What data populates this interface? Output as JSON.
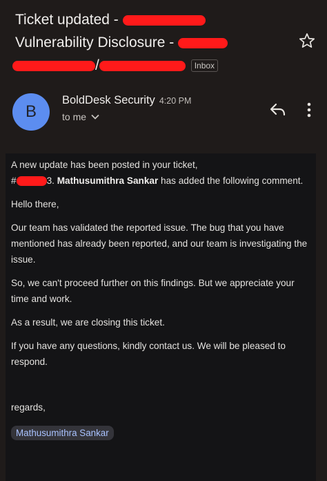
{
  "subject": {
    "line1": "Ticket updated -",
    "line2": "Vulnerability Disclosure -",
    "line3_sep": "/",
    "inbox_label": "Inbox"
  },
  "sender": {
    "avatar_letter": "B",
    "name": "BoldDesk Security",
    "time": "4:20 PM",
    "to": "to me"
  },
  "message": {
    "intro_line1": "A new update has been posted in your ticket,",
    "ticket_hash": "#",
    "ticket_suffix": "3.",
    "commenter": "Mathusumithra Sankar",
    "intro_tail": "has added the following comment.",
    "greeting": "Hello there,",
    "para1": "Our team has validated the reported issue. The bug that you have mentioned has already been reported, and our team is investigating the issue.",
    "para2": "So, we can't proceed further on this findings. But we appreciate your time and work.",
    "para3": "As a result, we are closing this ticket.",
    "para4": "If you have any questions, kindly contact us. We will be pleased to respond.",
    "regards": "regards,",
    "signature": "Mathusumithra Sankar"
  },
  "icons": {
    "star": "star-outline-icon",
    "reply": "reply-icon",
    "more": "more-vertical-icon",
    "expand": "chevron-down-icon"
  },
  "colors": {
    "background": "#1f1b1a",
    "avatar": "#5c8df0",
    "redaction": "#ff1a1a",
    "signature_link": "#a9c2ff"
  }
}
